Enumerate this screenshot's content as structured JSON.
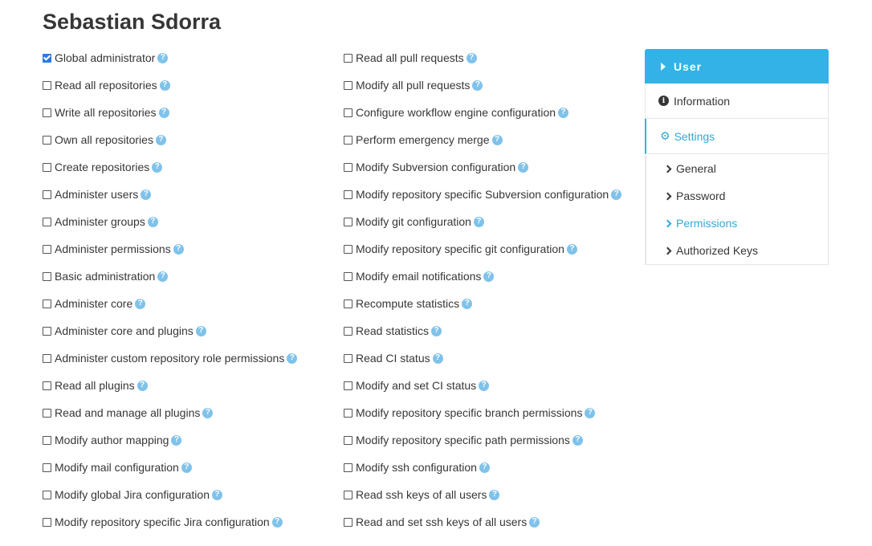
{
  "page": {
    "title": "Sebastian Sdorra"
  },
  "permissions": {
    "left": [
      {
        "label": "Global administrator",
        "checked": true
      },
      {
        "label": "Read all repositories",
        "checked": false
      },
      {
        "label": "Write all repositories",
        "checked": false
      },
      {
        "label": "Own all repositories",
        "checked": false
      },
      {
        "label": "Create repositories",
        "checked": false
      },
      {
        "label": "Administer users",
        "checked": false
      },
      {
        "label": "Administer groups",
        "checked": false
      },
      {
        "label": "Administer permissions",
        "checked": false
      },
      {
        "label": "Basic administration",
        "checked": false
      },
      {
        "label": "Administer core",
        "checked": false
      },
      {
        "label": "Administer core and plugins",
        "checked": false
      },
      {
        "label": "Administer custom repository role permissions",
        "checked": false
      },
      {
        "label": "Read all plugins",
        "checked": false
      },
      {
        "label": "Read and manage all plugins",
        "checked": false
      },
      {
        "label": "Modify author mapping",
        "checked": false
      },
      {
        "label": "Modify mail configuration",
        "checked": false
      },
      {
        "label": "Modify global Jira configuration",
        "checked": false
      },
      {
        "label": "Modify repository specific Jira configuration",
        "checked": false
      }
    ],
    "right": [
      {
        "label": "Read all pull requests",
        "checked": false
      },
      {
        "label": "Modify all pull requests",
        "checked": false
      },
      {
        "label": "Configure workflow engine configuration",
        "checked": false
      },
      {
        "label": "Perform emergency merge",
        "checked": false
      },
      {
        "label": "Modify Subversion configuration",
        "checked": false
      },
      {
        "label": "Modify repository specific Subversion configuration",
        "checked": false
      },
      {
        "label": "Modify git configuration",
        "checked": false
      },
      {
        "label": "Modify repository specific git configuration",
        "checked": false
      },
      {
        "label": "Modify email notifications",
        "checked": false
      },
      {
        "label": "Recompute statistics",
        "checked": false
      },
      {
        "label": "Read statistics",
        "checked": false
      },
      {
        "label": "Read CI status",
        "checked": false
      },
      {
        "label": "Modify and set CI status",
        "checked": false
      },
      {
        "label": "Modify repository specific branch permissions",
        "checked": false
      },
      {
        "label": "Modify repository specific path permissions",
        "checked": false
      },
      {
        "label": "Modify ssh configuration",
        "checked": false
      },
      {
        "label": "Read ssh keys of all users",
        "checked": false
      },
      {
        "label": "Read and set ssh keys of all users",
        "checked": false
      }
    ]
  },
  "sidebar": {
    "header": "User",
    "information": "Information",
    "settings": "Settings",
    "settings_items": [
      "General",
      "Password",
      "Permissions",
      "Authorized Keys"
    ],
    "active_settings_item": "Permissions"
  },
  "icons": {
    "help": "question-circle-icon",
    "info": "info-circle-icon",
    "settings": "gear-icon",
    "header": "caret-right-icon",
    "submenu": "chevron-right-icon"
  },
  "colors": {
    "accent": "#33b2e8",
    "link_active": "#33a8d8",
    "help_icon": "#7fc2ea",
    "checkbox_checked": "#2a7ae2"
  }
}
